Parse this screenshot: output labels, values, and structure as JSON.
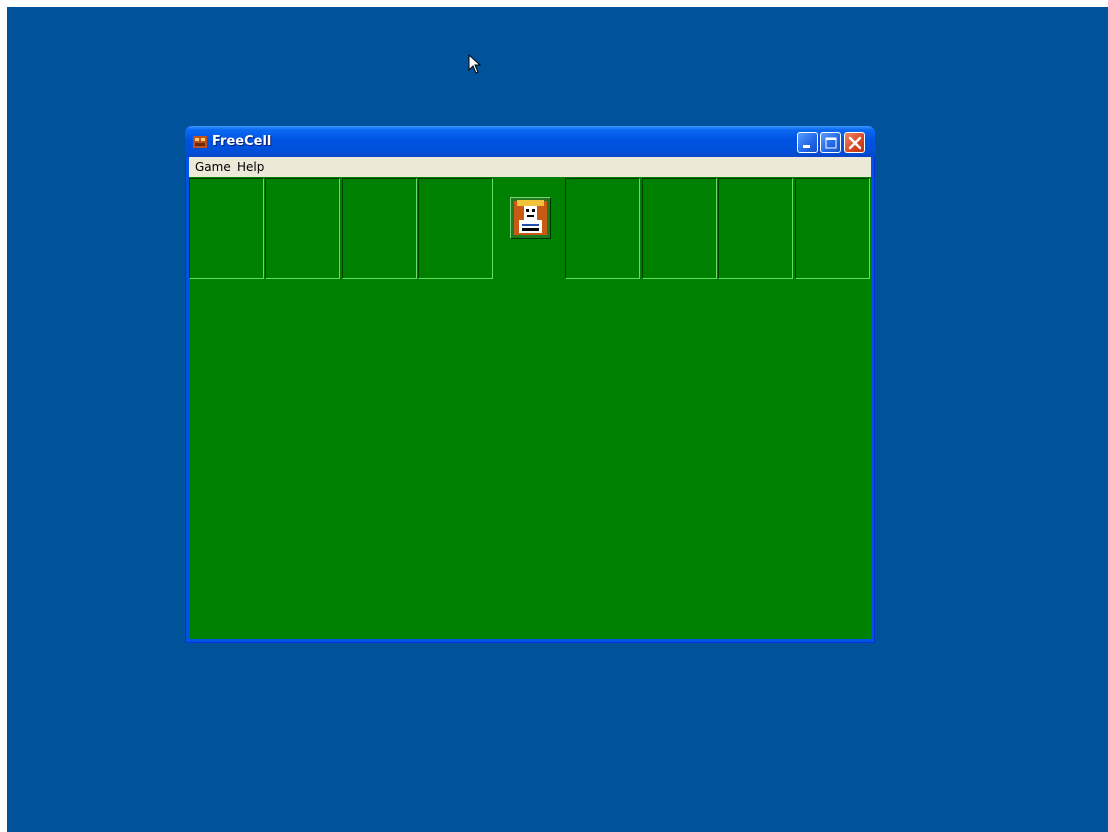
{
  "window": {
    "title": "FreeCell",
    "icon": "freecell-app-icon"
  },
  "controls": {
    "minimize_icon": "minimize-icon",
    "maximize_icon": "maximize-icon",
    "close_icon": "close-icon"
  },
  "menu": [
    {
      "label": "Game"
    },
    {
      "label": "Help"
    }
  ],
  "board": {
    "free_cells": [
      {},
      {},
      {},
      {}
    ],
    "home_cells": [
      {},
      {},
      {},
      {}
    ],
    "king_icon": "king-face-icon"
  },
  "colors": {
    "desktop": "#00529b",
    "felt": "#008000",
    "titlebar": "#0054e3",
    "menubar": "#ece9d8"
  }
}
